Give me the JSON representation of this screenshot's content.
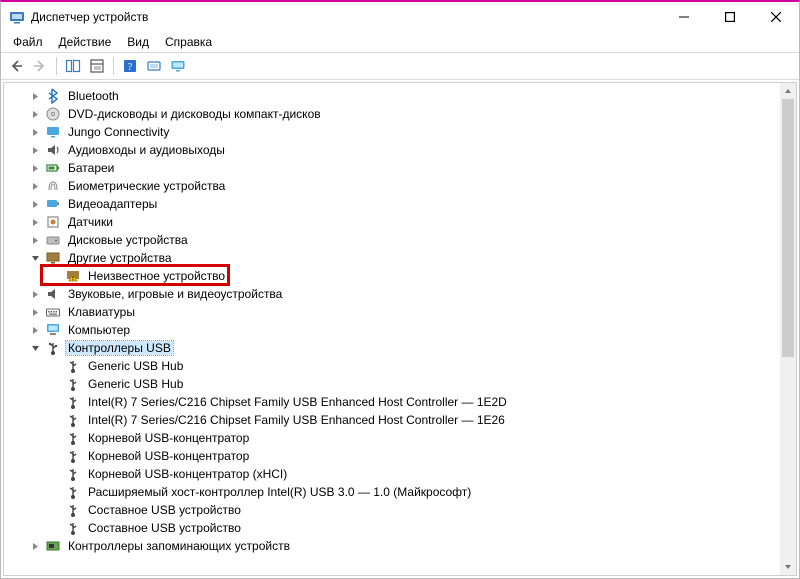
{
  "window": {
    "title": "Диспетчер устройств"
  },
  "menu": {
    "file": "Файл",
    "action": "Действие",
    "view": "Вид",
    "help": "Справка"
  },
  "tree": {
    "bluetooth": "Bluetooth",
    "dvd": "DVD-дисководы и дисководы компакт-дисков",
    "jungo": "Jungo Connectivity",
    "audio": "Аудиовходы и аудиовыходы",
    "battery": "Батареи",
    "biometric": "Биометрические устройства",
    "video": "Видеоадаптеры",
    "sensors": "Датчики",
    "disk": "Дисковые устройства",
    "other": "Другие устройства",
    "unknown": "Неизвестное устройство",
    "sound": "Звуковые, игровые и видеоустройства",
    "keyboard": "Клавиатуры",
    "computer": "Компьютер",
    "usb": "Контроллеры USB",
    "usb_children": {
      "hub1": "Generic USB Hub",
      "hub2": "Generic USB Hub",
      "intel1": "Intel(R) 7 Series/C216 Chipset Family USB Enhanced Host Controller — 1E2D",
      "intel2": "Intel(R) 7 Series/C216 Chipset Family USB Enhanced Host Controller — 1E26",
      "root1": "Корневой USB-концентратор",
      "root2": "Корневой USB-концентратор",
      "root3": "Корневой USB-концентратор (xHCI)",
      "xhci": "Расширяемый хост-контроллер Intel(R) USB 3.0 — 1.0 (Майкрософт)",
      "comp1": "Составное USB устройство",
      "comp2": "Составное USB устройство"
    },
    "storage": "Контроллеры запоминающих устройств"
  }
}
